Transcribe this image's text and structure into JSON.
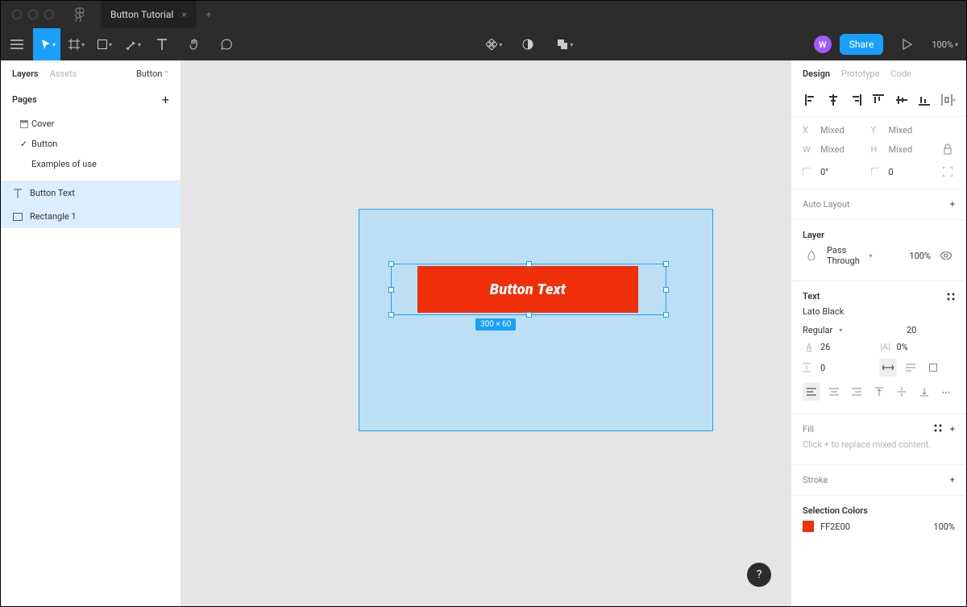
{
  "titlebar": {
    "tab_title": "Button Tutorial"
  },
  "toolbar": {
    "avatar_letter": "W",
    "share_label": "Share",
    "zoom_label": "100%"
  },
  "left_panel": {
    "tabs": {
      "layers": "Layers",
      "assets": "Assets",
      "selector": "Button"
    },
    "pages_label": "Pages",
    "pages": [
      {
        "label": "Cover",
        "active": false
      },
      {
        "label": "Button",
        "active": true
      },
      {
        "label": "Examples of use",
        "active": false
      }
    ],
    "layers": [
      {
        "label": "Button Text",
        "icon": "text"
      },
      {
        "label": "Rectangle 1",
        "icon": "rect"
      }
    ]
  },
  "canvas": {
    "button_text": "Button Text",
    "selection_dimensions": "300 × 60"
  },
  "right_panel": {
    "tabs": {
      "design": "Design",
      "prototype": "Prototype",
      "code": "Code"
    },
    "position": {
      "x_label": "X",
      "x_value": "Mixed",
      "y_label": "Y",
      "y_value": "Mixed",
      "w_label": "W",
      "w_value": "Mixed",
      "h_label": "H",
      "h_value": "Mixed",
      "rotation_value": "0°",
      "radius_value": "0"
    },
    "auto_layout_label": "Auto Layout",
    "layer_section": {
      "title": "Layer",
      "blend_mode": "Pass Through",
      "opacity": "100%"
    },
    "text_section": {
      "title": "Text",
      "font_family": "Lato Black",
      "font_weight": "Regular",
      "font_size": "20",
      "line_height": "26",
      "letter_spacing": "0%",
      "paragraph_spacing": "0"
    },
    "fill_section": {
      "title": "Fill",
      "hint": "Click + to replace mixed content."
    },
    "stroke_section": {
      "title": "Stroke"
    },
    "selection_colors": {
      "title": "Selection Colors",
      "hex": "FF2E00",
      "opacity": "100%"
    }
  }
}
